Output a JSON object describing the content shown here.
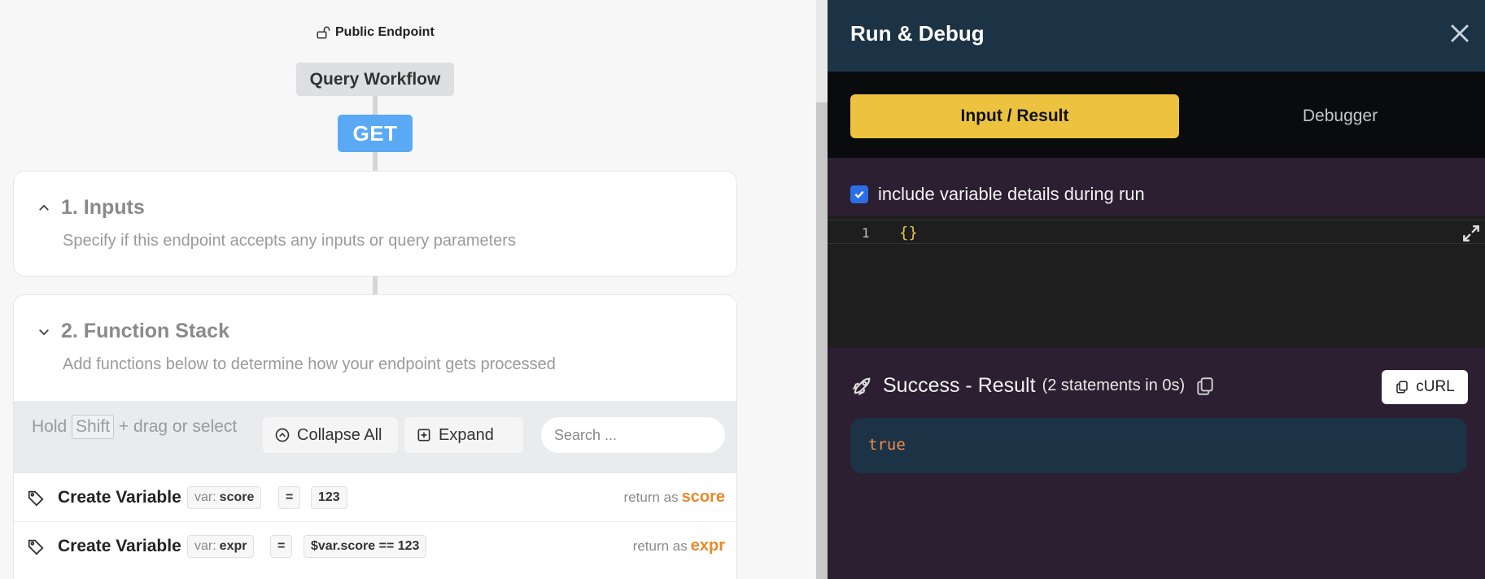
{
  "workflow": {
    "endpoint_label": "Public Endpoint",
    "name": "Query Workflow",
    "method": "GET"
  },
  "inputs_card": {
    "title": "1. Inputs",
    "description": "Specify if this endpoint accepts any inputs or query parameters"
  },
  "stack_card": {
    "title": "2. Function Stack",
    "description": "Add functions below to determine how your endpoint gets processed",
    "hold_prefix": "Hold",
    "hold_key": "Shift",
    "hold_suffix": "+ drag or select",
    "collapse_label": "Collapse All",
    "expand_label": "Expand",
    "search_placeholder": "Search ...",
    "rows": [
      {
        "name": "Create Variable",
        "var_prefix": "var:",
        "var_name": "score",
        "op": "=",
        "value": "123",
        "return_prefix": "return as",
        "return_name": "score"
      },
      {
        "name": "Create Variable",
        "var_prefix": "var:",
        "var_name": "expr",
        "op": "=",
        "value": "$var.score == 123",
        "return_prefix": "return as",
        "return_name": "expr"
      }
    ]
  },
  "panel": {
    "title": "Run & Debug",
    "tabs": [
      "Input / Result",
      "Debugger"
    ],
    "option_label": "include variable details during run",
    "editor": {
      "line_number": "1",
      "code": "{}"
    },
    "result_title": "Success - Result",
    "result_sub": "(2 statements in 0s)",
    "curl_label": "cURL",
    "result_value": "true"
  },
  "colors": {
    "accent": "#ecc23f",
    "method_blue": "#5aa9f5",
    "panel_header": "#1c3346",
    "panel_bg": "#2c1f32",
    "return_orange": "#e8892e",
    "result_orange": "#f08a4b"
  }
}
